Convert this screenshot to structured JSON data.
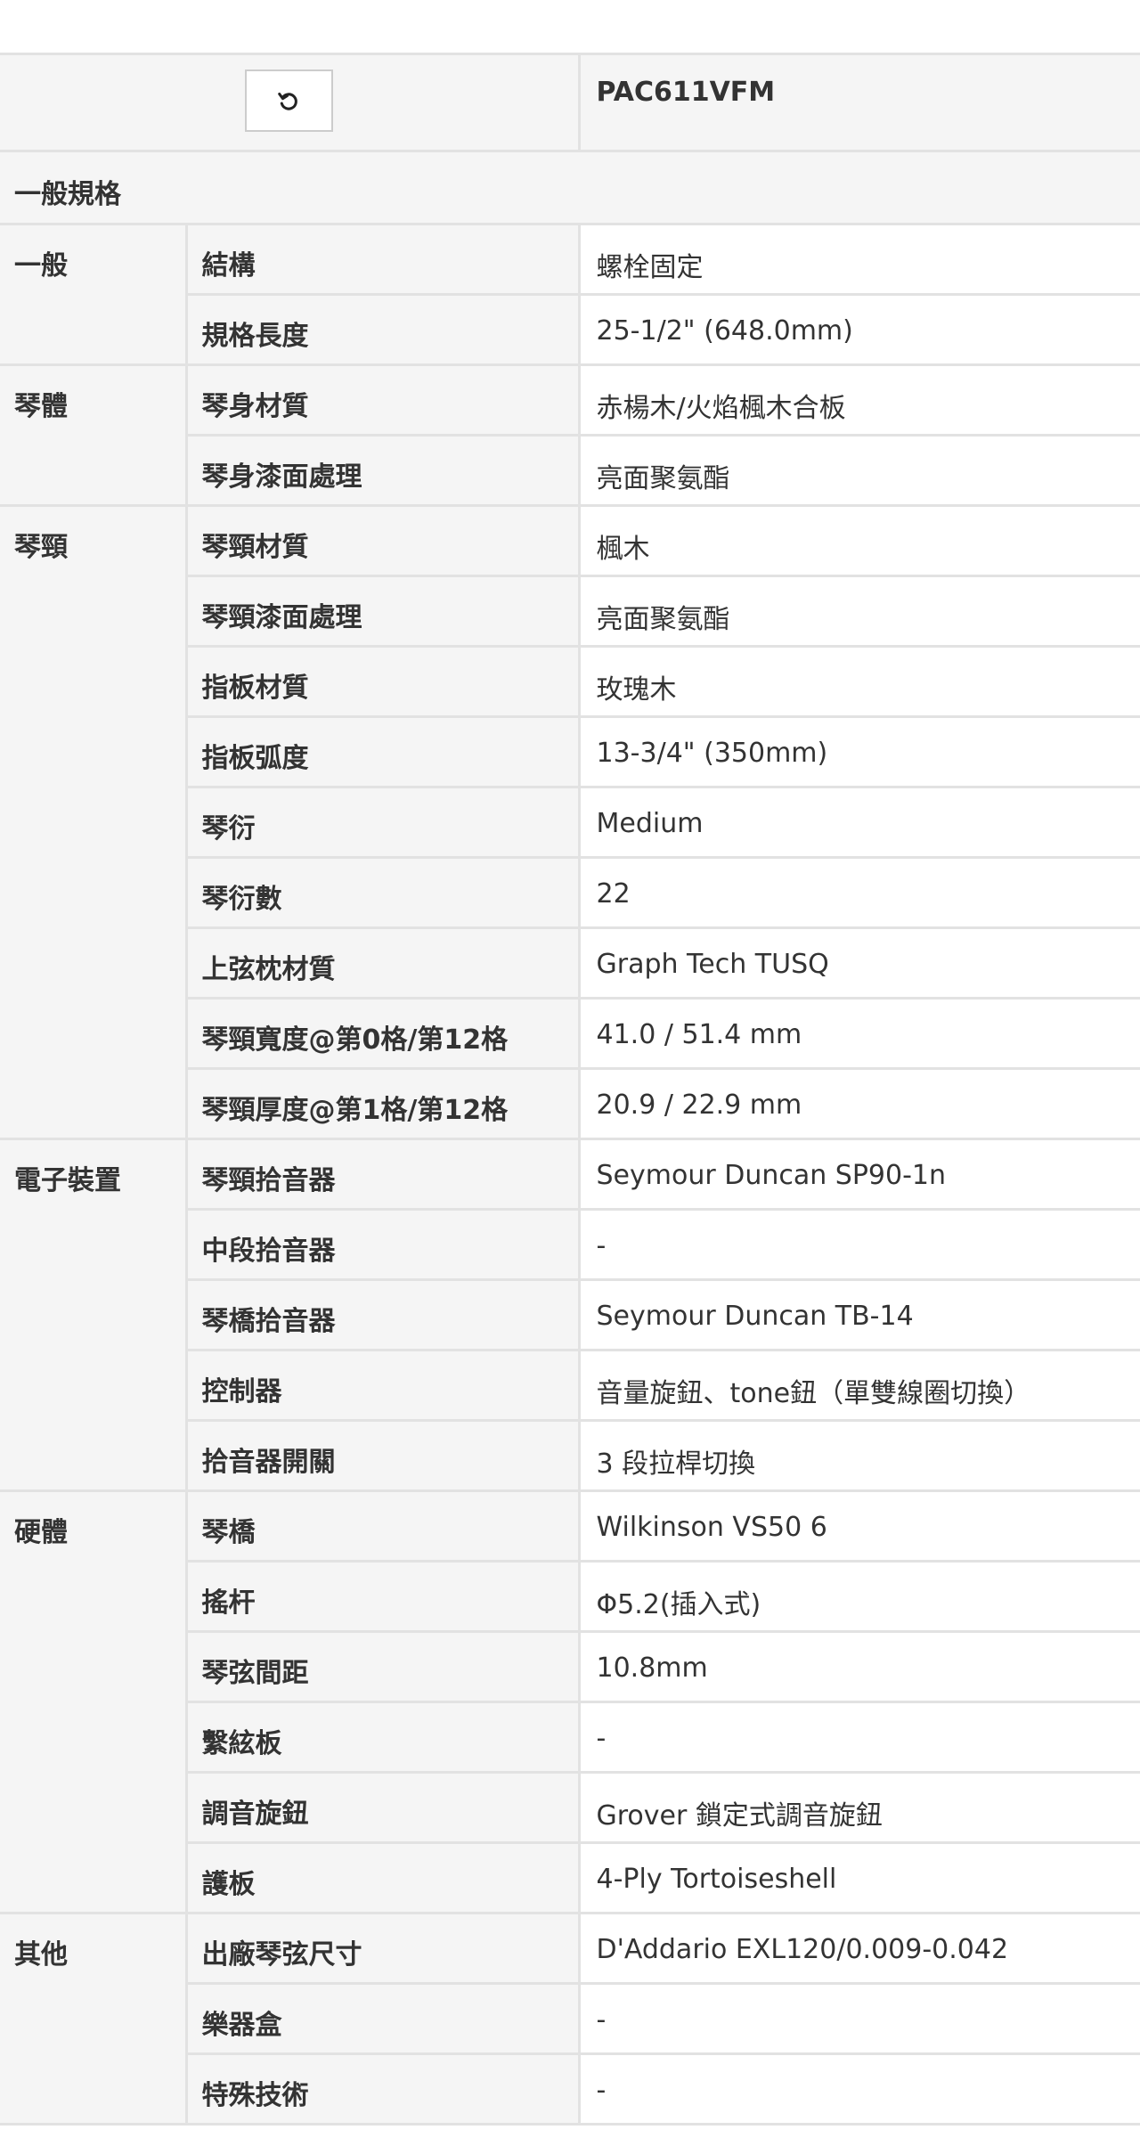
{
  "header": {
    "model": "PAC611VFM",
    "reset_icon": "reset-icon"
  },
  "section_title": "一般規格",
  "groups": [
    {
      "name": "一般",
      "rows": [
        {
          "label": "結構",
          "value": "螺栓固定"
        },
        {
          "label": "規格長度",
          "value": "25-1/2\" (648.0mm)"
        }
      ]
    },
    {
      "name": "琴體",
      "rows": [
        {
          "label": "琴身材質",
          "value": "赤楊木/火焰楓木合板"
        },
        {
          "label": "琴身漆面處理",
          "value": "亮面聚氨酯"
        }
      ]
    },
    {
      "name": "琴頸",
      "rows": [
        {
          "label": "琴頸材質",
          "value": "楓木"
        },
        {
          "label": "琴頸漆面處理",
          "value": "亮面聚氨酯"
        },
        {
          "label": "指板材質",
          "value": "玫瑰木"
        },
        {
          "label": "指板弧度",
          "value": "13-3/4\" (350mm)"
        },
        {
          "label": "琴衍",
          "value": "Medium"
        },
        {
          "label": "琴衍數",
          "value": "22"
        },
        {
          "label": "上弦枕材質",
          "value": "Graph Tech TUSQ"
        },
        {
          "label": "琴頸寬度@第0格/第12格",
          "value": "41.0 / 51.4 mm"
        },
        {
          "label": "琴頸厚度@第1格/第12格",
          "value": "20.9 / 22.9 mm"
        }
      ]
    },
    {
      "name": "電子裝置",
      "rows": [
        {
          "label": "琴頸拾音器",
          "value": "Seymour Duncan SP90-1n"
        },
        {
          "label": "中段拾音器",
          "value": "-"
        },
        {
          "label": "琴橋拾音器",
          "value": "Seymour Duncan TB-14"
        },
        {
          "label": "控制器",
          "value": "音量旋鈕、tone鈕（單雙線圈切換）"
        },
        {
          "label": "拾音器開關",
          "value": "3 段拉桿切換"
        }
      ]
    },
    {
      "name": "硬體",
      "rows": [
        {
          "label": "琴橋",
          "value": "Wilkinson VS50 6"
        },
        {
          "label": "搖杆",
          "value": "Φ5.2(插入式)"
        },
        {
          "label": "琴弦間距",
          "value": "10.8mm"
        },
        {
          "label": "繫絃板",
          "value": "-"
        },
        {
          "label": "調音旋鈕",
          "value": "Grover 鎖定式調音旋鈕"
        },
        {
          "label": "護板",
          "value": "4-Ply Tortoiseshell"
        }
      ]
    },
    {
      "name": "其他",
      "rows": [
        {
          "label": "出廠琴弦尺寸",
          "value": "D'Addario EXL120/0.009-0.042"
        },
        {
          "label": "樂器盒",
          "value": "-"
        },
        {
          "label": "特殊技術",
          "value": "-"
        }
      ]
    }
  ]
}
